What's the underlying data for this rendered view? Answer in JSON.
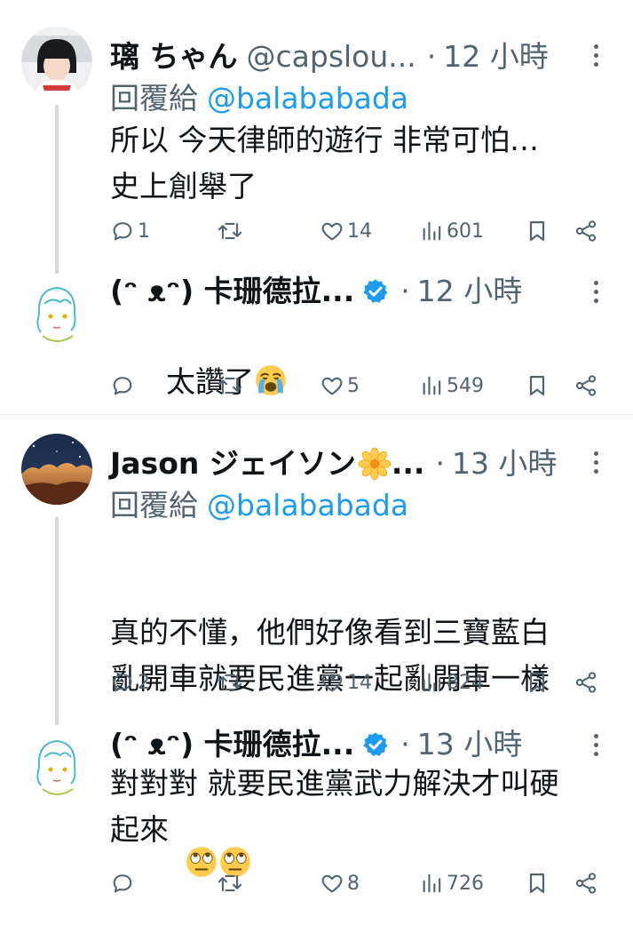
{
  "feed": {
    "tweets": [
      {
        "username": "璃 ちゃん",
        "handle": "@capslou...",
        "time": "12 小時",
        "reply_prefix": "回覆給",
        "reply_to": "@balababada",
        "text": "所以 今天律師的遊行 非常可怕…\n史上創舉了",
        "stats": {
          "replies": "1",
          "retweets": "",
          "likes": "14",
          "views": "601"
        }
      },
      {
        "username": "(ᵔ ᴥᵔ) 卡珊德拉...",
        "verified": true,
        "time": "12 小時",
        "text": "太讚了",
        "emoji": "loudly-crying-face",
        "stats": {
          "replies": "",
          "retweets": "",
          "likes": "5",
          "views": "549"
        }
      },
      {
        "username": "Jason ジェイソン",
        "username_suffix": "...",
        "name_emoji": "blossom",
        "time": "13 小時",
        "reply_prefix": "回覆給",
        "reply_to": "@balababada",
        "text": "真的不懂，他們好像看到三寶藍白\n亂開車就要民進黨一起亂開車一樣",
        "emojis": [
          "face-with-rolling-eyes",
          "face-with-rolling-eyes"
        ],
        "stats": {
          "replies": "2",
          "retweets": "",
          "likes": "14",
          "views": "824"
        }
      },
      {
        "username": "(ᵔ ᴥᵔ) 卡珊德拉...",
        "verified": true,
        "time": "13 小時",
        "text": "對對對 就要民進黨武力解決才叫硬\n起來",
        "stats": {
          "replies": "",
          "retweets": "",
          "likes": "8",
          "views": "726"
        }
      }
    ]
  },
  "colors": {
    "text": "#0f1419",
    "secondary": "#536471",
    "link": "#1d9bf0",
    "verified": "#1d9bf0",
    "thread_line": "#cfd9de"
  }
}
